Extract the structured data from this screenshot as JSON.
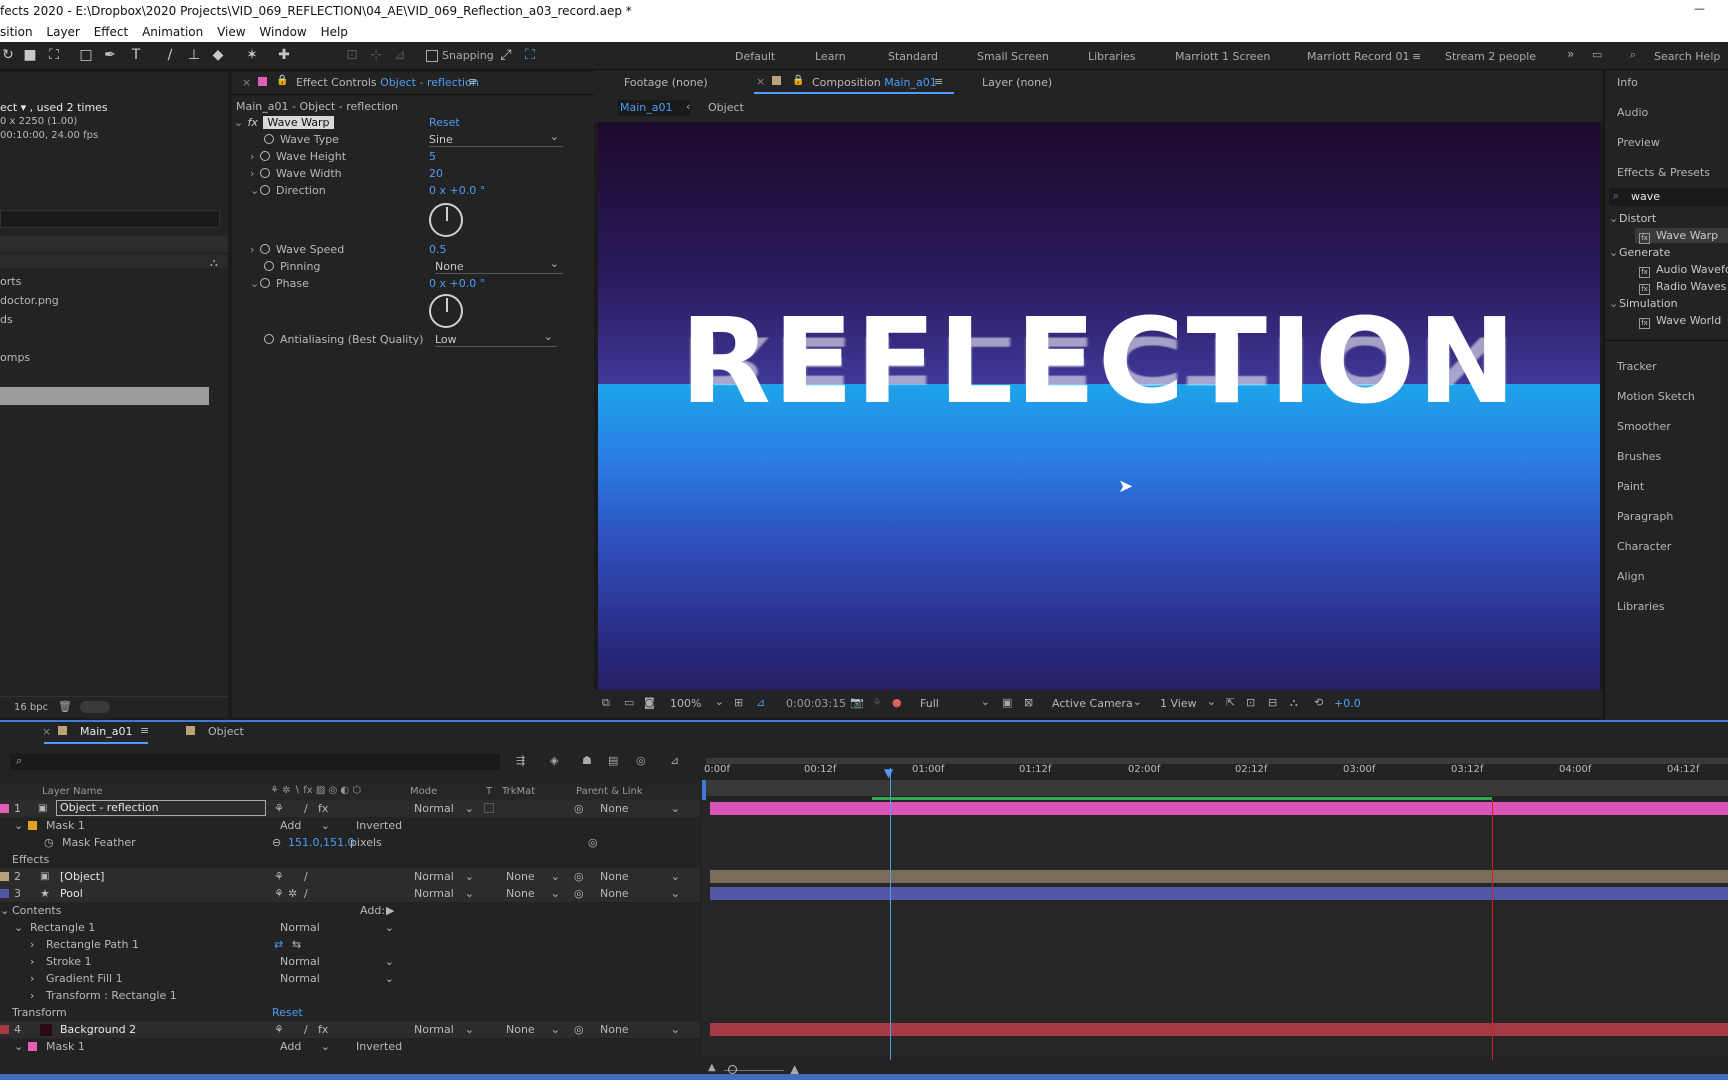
{
  "window": {
    "title": "fects 2020 - E:\\Dropbox\\2020 Projects\\VID_069_REFLECTION\\04_AE\\VID_069_Reflection_a03_record.aep *"
  },
  "menu": [
    "sition",
    "Layer",
    "Effect",
    "Animation",
    "View",
    "Window",
    "Help"
  ],
  "toolbar": {
    "snapping_label": "Snapping",
    "workspaces": [
      "Default",
      "Learn",
      "Standard",
      "Small Screen",
      "Libraries",
      "Marriott 1 Screen",
      "Marriott Record 01",
      "Stream 2 people"
    ],
    "active_workspace": "Marriott Record 01",
    "search_placeholder": "Search Help"
  },
  "project": {
    "info_line1": "ect ▾ , used 2 times",
    "info_line2": "0 x 2250 (1.00)",
    "info_line3": "00:10:00, 24.00 fps",
    "items": [
      "orts",
      "doctor.png",
      "ds",
      "omps"
    ],
    "bpc": "16 bpc"
  },
  "effect_controls": {
    "tab_prefix": "Effect Controls",
    "tab_target": "Object - reflection",
    "subtitle": "Main_a01 - Object - reflection",
    "effect_name": "Wave Warp",
    "reset_label": "Reset",
    "params": {
      "wave_type": {
        "label": "Wave Type",
        "value": "Sine"
      },
      "wave_height": {
        "label": "Wave Height",
        "value": "5"
      },
      "wave_width": {
        "label": "Wave Width",
        "value": "20"
      },
      "direction": {
        "label": "Direction",
        "value": "0 x +0.0 °"
      },
      "wave_speed": {
        "label": "Wave Speed",
        "value": "0.5"
      },
      "pinning": {
        "label": "Pinning",
        "value": "None"
      },
      "phase": {
        "label": "Phase",
        "value": "0 x +0.0 °"
      },
      "antialiasing": {
        "label": "Antialiasing (Best Quality)",
        "value": "Low"
      }
    }
  },
  "viewer": {
    "tab_footage": "Footage (none)",
    "tab_comp_prefix": "Composition",
    "tab_comp_name": "Main_a01",
    "tab_layer": "Layer (none)",
    "crumb_main": "Main_a01",
    "crumb_object": "Object",
    "comp_text": "REFLECTION",
    "zoom": "100%",
    "timecode": "0:00:03:15",
    "resolution": "Full",
    "camera": "Active Camera",
    "views": "1 View",
    "exposure": "+0.0"
  },
  "right_panel": {
    "items_top": [
      "Info",
      "Audio",
      "Preview",
      "Effects & Presets"
    ],
    "search_value": "wave",
    "groups": [
      {
        "name": "Distort",
        "effects": [
          "Wave Warp"
        ]
      },
      {
        "name": "Generate",
        "effects": [
          "Audio Wavefo",
          "Radio Waves"
        ]
      },
      {
        "name": "Simulation",
        "effects": [
          "Wave World"
        ]
      }
    ],
    "items_bottom": [
      "Tracker",
      "Motion Sketch",
      "Smoother",
      "Brushes",
      "Paint",
      "Paragraph",
      "Character",
      "Align",
      "Libraries"
    ]
  },
  "timeline": {
    "tab_main": "Main_a01",
    "tab_object": "Object",
    "columns": {
      "layer_name": "Layer Name",
      "mode": "Mode",
      "t": "T",
      "trkmat": "TrkMat",
      "parent": "Parent & Link"
    },
    "ruler": [
      "0:00f",
      "00:12f",
      "01:00f",
      "01:12f",
      "02:00f",
      "02:12f",
      "03:00f",
      "03:12f",
      "04:00f",
      "04:12f"
    ],
    "rows": {
      "l1_num": "1",
      "l1_name": "Object - reflection",
      "l1_mode": "Normal",
      "l1_parent": "None",
      "mask1": "Mask 1",
      "mask1_mode": "Add",
      "mask1_inverted": "Inverted",
      "mask_feather": "Mask Feather",
      "mask_feather_value": "151.0,151.0",
      "mask_feather_unit": "pixels",
      "effects": "Effects",
      "l2_num": "2",
      "l2_name": "[Object]",
      "l2_mode": "Normal",
      "l2_trkmat": "None",
      "l2_parent": "None",
      "l3_num": "3",
      "l3_name": "Pool",
      "l3_mode": "Normal",
      "l3_trkmat": "None",
      "l3_parent": "None",
      "contents": "Contents",
      "add_label": "Add:",
      "rect1": "Rectangle 1",
      "rect1_mode": "Normal",
      "rect_path": "Rectangle Path 1",
      "stroke": "Stroke 1",
      "stroke_mode": "Normal",
      "gradient": "Gradient Fill 1",
      "gradient_mode": "Normal",
      "transform_rect": "Transform : Rectangle 1",
      "transform": "Transform",
      "transform_reset": "Reset",
      "l4_num": "4",
      "l4_name": "Background 2",
      "l4_mode": "Normal",
      "l4_trkmat": "None",
      "l4_parent": "None",
      "mask1b": "Mask 1",
      "mask1b_mode": "Add",
      "mask1b_inverted": "Inverted"
    },
    "playhead_position": "0:00:03:15"
  },
  "colors": {
    "accent_blue": "#4d9cf7",
    "layer1_bar": "#d955b8",
    "layer2_bar": "#7b6b58",
    "layer3_bar": "#5357a8",
    "layer4_bar": "#a33a44"
  }
}
